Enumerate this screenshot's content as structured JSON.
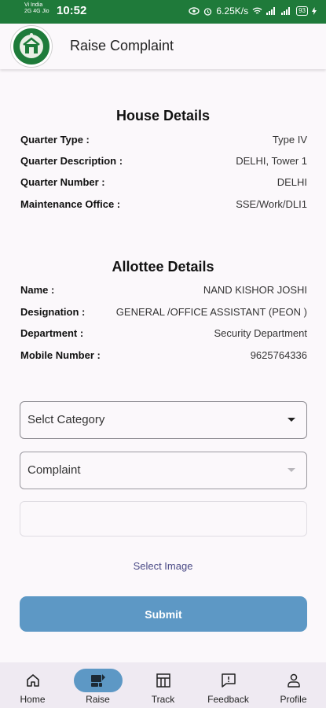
{
  "status_bar": {
    "carrier_line1": "Vi India",
    "carrier_line2": "2G 4G Jio",
    "time": "10:52",
    "net_speed": "6.25K/s",
    "battery": "93"
  },
  "app_bar": {
    "title": "Raise Complaint"
  },
  "house_details": {
    "title": "House Details",
    "rows": [
      {
        "label": "Quarter Type :",
        "value": "Type IV"
      },
      {
        "label": "Quarter Description :",
        "value": "DELHI, Tower 1"
      },
      {
        "label": "Quarter Number :",
        "value": "DELHI"
      },
      {
        "label": "Maintenance Office :",
        "value": "SSE/Work/DLI1"
      }
    ]
  },
  "allottee_details": {
    "title": "Allottee Details",
    "rows": [
      {
        "label": "Name :",
        "value": "NAND KISHOR JOSHI"
      },
      {
        "label": "Designation :",
        "value": "GENERAL /OFFICE ASSISTANT (PEON )"
      },
      {
        "label": "Department :",
        "value": "Security Department"
      },
      {
        "label": "Mobile Number :",
        "value": "9625764336"
      }
    ]
  },
  "form": {
    "category_placeholder": "Selct Category",
    "complaint_placeholder": "Complaint",
    "select_image": "Select Image",
    "submit": "Submit"
  },
  "bottom_nav": {
    "items": [
      {
        "label": "Home",
        "icon": "home-icon"
      },
      {
        "label": "Raise",
        "icon": "raise-icon"
      },
      {
        "label": "Track",
        "icon": "track-icon"
      },
      {
        "label": "Feedback",
        "icon": "feedback-icon"
      },
      {
        "label": "Profile",
        "icon": "profile-icon"
      }
    ],
    "active": "Raise"
  },
  "colors": {
    "status_bar": "#1f7a3a",
    "accent": "#5d98c5",
    "link": "#4a4a86",
    "background": "#fbf8fb",
    "nav_background": "#efeaf2"
  }
}
